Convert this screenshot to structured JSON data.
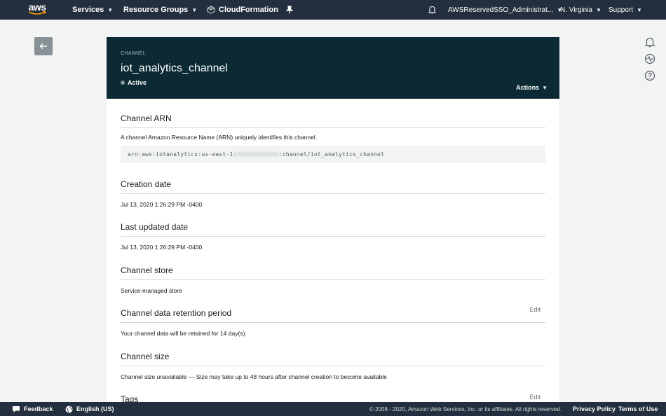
{
  "nav": {
    "logo_text": "aws",
    "services": "Services",
    "resource_groups": "Resource Groups",
    "cloudformation": "CloudFormation",
    "account": "AWSReservedSSO_Administrat...",
    "region": "N. Virginia",
    "support": "Support"
  },
  "header": {
    "eyebrow": "CHANNEL",
    "title": "iot_analytics_channel",
    "status": "Active",
    "actions": "Actions"
  },
  "sections": {
    "arn": {
      "title": "Channel ARN",
      "description": "A channel Amazon Resource Name (ARN) uniquely identifies this channel.",
      "arn_prefix": "arn:aws:iotanalytics:us-east-1:",
      "arn_account": "000000000000",
      "arn_suffix": ":channel/iot_analytics_channel"
    },
    "creation": {
      "title": "Creation date",
      "value": "Jul 13, 2020 1:26:29 PM -0400"
    },
    "updated": {
      "title": "Last updated date",
      "value": "Jul 13, 2020 1:26:29 PM -0400"
    },
    "store": {
      "title": "Channel store",
      "value": "Service-managed store"
    },
    "retention": {
      "title": "Channel data retention period",
      "edit": "Edit",
      "value": "Your channel data will be retained for 14 day(s)."
    },
    "size": {
      "title": "Channel size",
      "value": "Channel size unavailable — Size may take up to 48 hours after channel creation to become available"
    },
    "tags": {
      "title": "Tags",
      "edit": "Edit"
    }
  },
  "footer": {
    "feedback": "Feedback",
    "language": "English (US)",
    "copyright": "© 2008 - 2020, Amazon Web Services, Inc. or its affiliates. All rights reserved.",
    "privacy": "Privacy Policy",
    "terms": "Terms of Use"
  },
  "colors": {
    "nav_bg": "#232f3e",
    "header_bg": "#0b2a33",
    "page_bg": "#f2f3f3",
    "status_gray": "#879196"
  },
  "icons": [
    "aws-logo",
    "cube-icon",
    "pin-icon",
    "bell-icon",
    "back-arrow-icon",
    "notification-icon",
    "health-icon",
    "help-icon",
    "chat-icon",
    "globe-icon"
  ]
}
